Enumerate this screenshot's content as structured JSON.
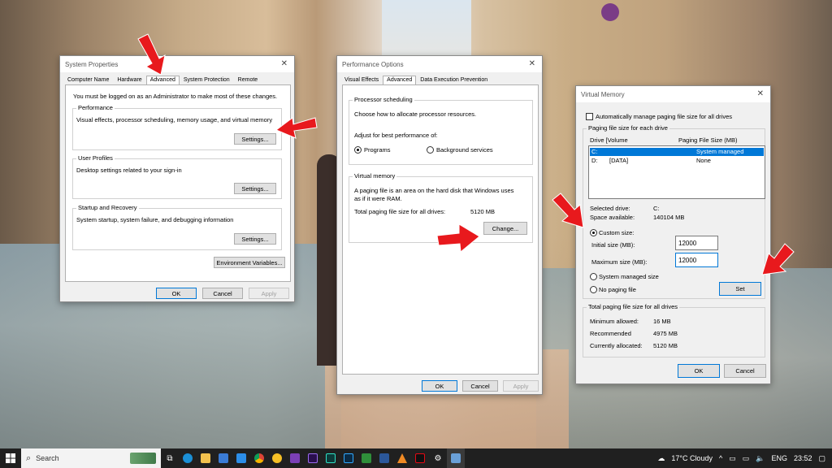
{
  "system_properties": {
    "title": "System Properties",
    "tabs": [
      "Computer Name",
      "Hardware",
      "Advanced",
      "System Protection",
      "Remote"
    ],
    "admin_note": "You must be logged on as an Administrator to make most of these changes.",
    "performance": {
      "label": "Performance",
      "desc": "Visual effects, processor scheduling, memory usage, and virtual memory",
      "button": "Settings..."
    },
    "user_profiles": {
      "label": "User Profiles",
      "desc": "Desktop settings related to your sign-in",
      "button": "Settings..."
    },
    "startup": {
      "label": "Startup and Recovery",
      "desc": "System startup, system failure, and debugging information",
      "button": "Settings..."
    },
    "env_button": "Environment Variables...",
    "ok": "OK",
    "cancel": "Cancel",
    "apply": "Apply"
  },
  "performance_options": {
    "title": "Performance Options",
    "tabs": [
      "Visual Effects",
      "Advanced",
      "Data Execution Prevention"
    ],
    "processor": {
      "label": "Processor scheduling",
      "desc": "Choose how to allocate processor resources.",
      "adjust": "Adjust for best performance of:",
      "programs": "Programs",
      "background": "Background services"
    },
    "vm": {
      "label": "Virtual memory",
      "desc1": "A paging file is an area on the hard disk that Windows uses",
      "desc2": "as if it were RAM.",
      "total_label": "Total paging file size for all drives:",
      "total_value": "5120 MB",
      "change": "Change..."
    },
    "ok": "OK",
    "cancel": "Cancel",
    "apply": "Apply"
  },
  "virtual_memory": {
    "title": "Virtual Memory",
    "auto_manage": "Automatically manage paging file size for all drives",
    "section": "Paging file size for each drive",
    "col_drive": "Drive  [Volume",
    "col_size": "Paging File Size (MB)",
    "rows": [
      {
        "drive": "C:",
        "volume": "",
        "size": "System managed"
      },
      {
        "drive": "D:",
        "volume": "[DATA]",
        "size": "None"
      }
    ],
    "selected_drive_label": "Selected drive:",
    "selected_drive": "C:",
    "space_label": "Space available:",
    "space": "140104 MB",
    "custom_size": "Custom size:",
    "initial_label": "Initial size (MB):",
    "initial_value": "12000",
    "max_label": "Maximum size (MB):",
    "max_value": "12000",
    "system_managed": "System managed size",
    "no_paging": "No paging file",
    "set": "Set",
    "total_section": "Total paging file size for all drives",
    "min_label": "Minimum allowed:",
    "min_value": "16 MB",
    "rec_label": "Recommended",
    "rec_value": "4975 MB",
    "cur_label": "Currently allocated:",
    "cur_value": "5120 MB",
    "ok": "OK",
    "cancel": "Cancel"
  },
  "taskbar": {
    "search": "Search",
    "weather": "17°C  Cloudy",
    "lang": "ENG",
    "time": "23:52"
  }
}
